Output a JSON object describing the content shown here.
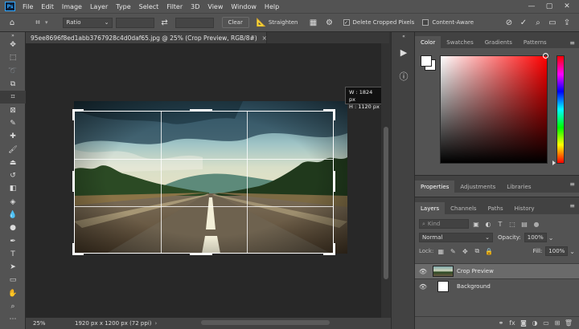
{
  "app": {
    "logo": "Ps"
  },
  "menu": [
    "File",
    "Edit",
    "Image",
    "Layer",
    "Type",
    "Select",
    "Filter",
    "3D",
    "View",
    "Window",
    "Help"
  ],
  "window_controls": {
    "minimize": "—",
    "maximize": "▢",
    "close": "✕"
  },
  "options_bar": {
    "ratio_label": "Ratio",
    "swap_icon": "⇄",
    "clear_label": "Clear",
    "straighten_label": "Straighten",
    "delete_cropped_label": "Delete Cropped Pixels",
    "delete_cropped_checked": true,
    "content_aware_label": "Content-Aware",
    "content_aware_checked": false
  },
  "document": {
    "tab_title": "95ee8696f8ed1abb3767928c4d0daf65.jpg @ 25% (Crop Preview, RGB/8#)",
    "close_glyph": "×",
    "zoom": "25%",
    "doc_info": "1920 px x 1200 px (72 ppi)"
  },
  "crop_tooltip": {
    "w": "W :  1824 px",
    "h": "H :  1120 px"
  },
  "color_panel": {
    "tabs": [
      "Color",
      "Swatches",
      "Gradients",
      "Patterns"
    ]
  },
  "properties_panel": {
    "tabs": [
      "Properties",
      "Adjustments",
      "Libraries"
    ]
  },
  "layers_panel": {
    "tabs": [
      "Layers",
      "Channels",
      "Paths",
      "History"
    ],
    "kind_placeholder": "Kind",
    "blend_mode": "Normal",
    "opacity_label": "Opacity:",
    "opacity_value": "100%",
    "lock_label": "Lock:",
    "fill_label": "Fill:",
    "fill_value": "100%",
    "layers": [
      {
        "name": "Crop Preview",
        "selected": true
      },
      {
        "name": "Background",
        "selected": false
      }
    ]
  }
}
